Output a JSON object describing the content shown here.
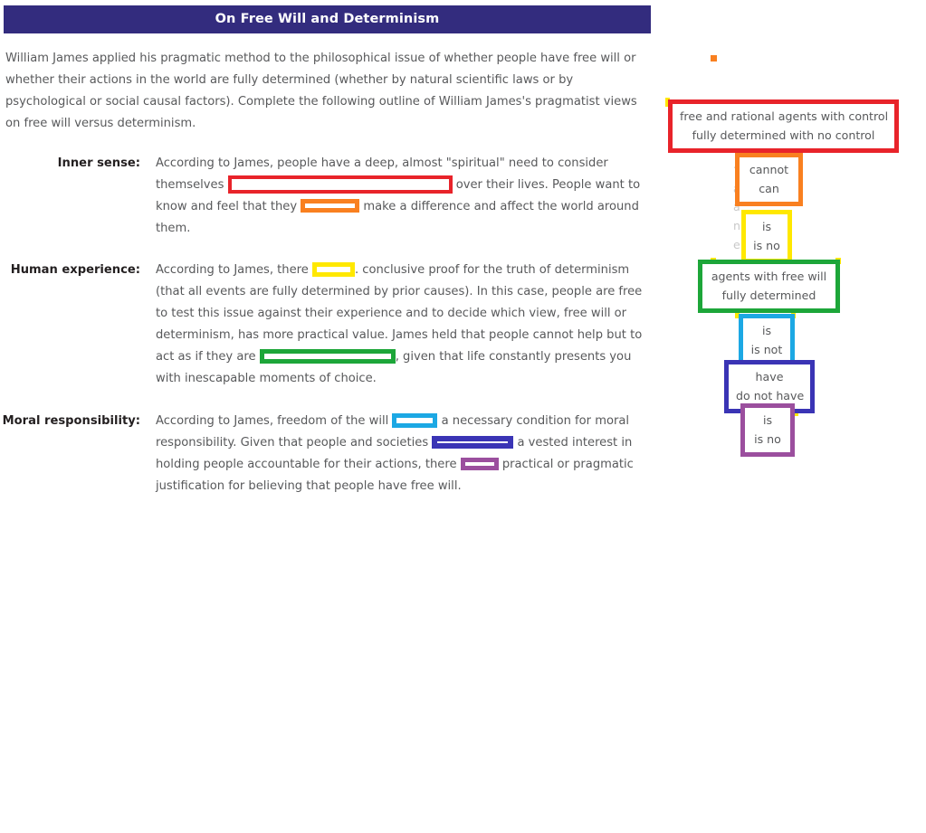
{
  "document": {
    "title": "On Free Will and Determinism",
    "title_bar_color": "#332C7E",
    "intro": "William James applied his pragmatic method to the philosophical issue of whether people have free will or whether their actions in the world are fully determined (whether by natural scientific laws or by psychological or social causal factors). Complete the following outline of William James's pragmatist views on free will versus determinism.",
    "sections": [
      {
        "label": "Inner sense:",
        "text_before_blank1": "According to James, people have a deep, almost \"spiritual\" need to consider themselves ",
        "blank1_color": "#E8232A",
        "text_after_blank1": " over their lives. People want to know and feel that they ",
        "blank2_color": "#F98020",
        "text_after_blank2": " make a difference and affect the world around them."
      },
      {
        "label": "Human experience:",
        "text_before_blank1": "According to James, there ",
        "blank1_color": "#FFE800",
        "text_after_blank1": ". conclusive proof for the truth of determinism (that all events are fully determined by prior causes). In this case, people are free to test this issue against their experience and to decide which view, free will or determinism, has more practical value. James held that people cannot help but to act as if they are ",
        "blank2_color": "#1DA639",
        "text_after_blank2": ", given that life constantly presents you with inescapable moments of choice."
      },
      {
        "label": "Moral responsibility:",
        "text_before_blank1": "According to James, freedom of the will ",
        "blank1_color": "#1CA8E4",
        "text_after_blank1": " a necessary condition for moral responsibility. Given that people and societies ",
        "blank2_color": "#3A34B5",
        "text_after_blank2": " a vested interest in holding people accountable for their actions, there ",
        "blank3_color": "#9B4F9E",
        "text_after_blank3": " practical or pragmatic justification for believing that people have free will."
      }
    ]
  },
  "answer_panel": {
    "options": [
      {
        "id": "option-red",
        "border_color": "#E8232A",
        "lines": [
          "free and rational agents with control",
          "fully determined with no control"
        ]
      },
      {
        "id": "option-orange",
        "border_color": "#F98020",
        "lines": [
          "cannot",
          "can"
        ]
      },
      {
        "id": "option-yellow",
        "border_color": "#FFE800",
        "lines": [
          "is",
          "is no"
        ]
      },
      {
        "id": "option-green",
        "border_color": "#1DA639",
        "lines": [
          "agents with free will",
          "fully determined"
        ]
      },
      {
        "id": "option-cyan",
        "border_color": "#1CA8E4",
        "lines": [
          "is",
          "is not"
        ]
      },
      {
        "id": "option-blue",
        "border_color": "#3A34B5",
        "lines": [
          "have",
          "do not have"
        ]
      },
      {
        "id": "option-purple",
        "border_color": "#9B4F9E",
        "lines": [
          "is",
          "is no"
        ]
      }
    ],
    "marker_color": "#F98020",
    "tick_color": "#FFE800"
  }
}
